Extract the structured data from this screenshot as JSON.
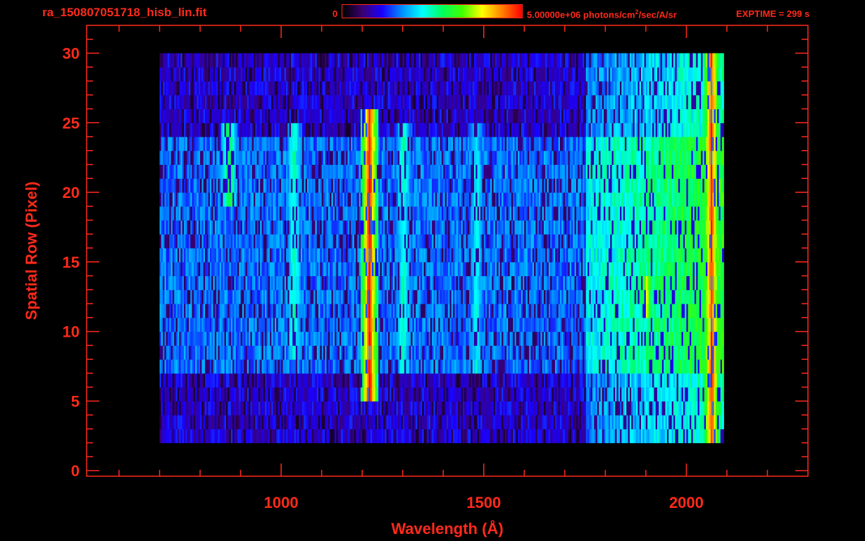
{
  "header": {
    "file_title": "ra_150807051718_hisb_lin.fit",
    "colorbar_min": "0",
    "colorbar_max_prefix": "5.00000e+06 photons/cm",
    "colorbar_max_sup": "2",
    "colorbar_max_suffix": "/sec/A/sr",
    "exptime": "EXPTIME = 299 s"
  },
  "colors": {
    "axis": "#ff2a1a",
    "background": "#000000",
    "colormap": [
      "#000000",
      "#3a006f",
      "#1a00ff",
      "#0090ff",
      "#00ffff",
      "#00ff60",
      "#40ff00",
      "#ffff00",
      "#ff8000",
      "#ff0000"
    ]
  },
  "chart_data": {
    "type": "heatmap",
    "title": "ra_150807051718_hisb_lin.fit",
    "xlabel": "Wavelength (Å)",
    "ylabel": "Spatial Row (Pixel)",
    "xlim": [
      520,
      2300
    ],
    "ylim": [
      -0.4,
      32
    ],
    "xticks": [
      1000,
      1500,
      2000
    ],
    "xtick_labels": [
      "1000",
      "1500",
      "2000"
    ],
    "yticks": [
      0,
      5,
      10,
      15,
      20,
      25,
      30
    ],
    "ytick_labels": [
      "0",
      "5",
      "10",
      "15",
      "20",
      "25",
      "30"
    ],
    "colorbar": {
      "min": 0,
      "max": 5000000,
      "units": "photons/cm^2/sec/A/sr"
    },
    "data_extent": {
      "wavelength": [
        700,
        2090
      ],
      "rows": [
        2,
        30
      ]
    },
    "bright_features": [
      {
        "wavelength": 870,
        "rows": [
          19,
          24
        ],
        "intensity": 0.55
      },
      {
        "wavelength": 1030,
        "rows": [
          8,
          24
        ],
        "intensity": 0.45
      },
      {
        "wavelength": 1216,
        "rows": [
          5,
          25
        ],
        "intensity": 0.95
      },
      {
        "wavelength": 1300,
        "rows": [
          7,
          24
        ],
        "intensity": 0.45
      },
      {
        "wavelength": 1480,
        "rows": [
          7,
          24
        ],
        "intensity": 0.4
      },
      {
        "wavelength": 1900,
        "rows": [
          11,
          13
        ],
        "intensity": 0.7
      },
      {
        "wavelength": 2060,
        "rows": [
          2,
          30
        ],
        "intensity": 0.9
      }
    ]
  }
}
